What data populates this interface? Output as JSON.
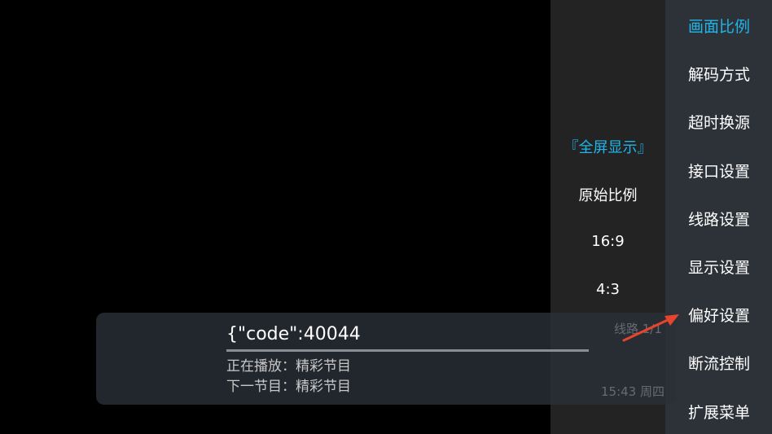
{
  "ratio_options": [
    {
      "label": "『全屏显示』",
      "active": true
    },
    {
      "label": "原始比例",
      "active": false
    },
    {
      "label": "16:9",
      "active": false
    },
    {
      "label": "4:3",
      "active": false
    }
  ],
  "menu": {
    "items": [
      {
        "label": "画面比例",
        "active": true
      },
      {
        "label": "解码方式",
        "active": false
      },
      {
        "label": "超时换源",
        "active": false
      },
      {
        "label": "接口设置",
        "active": false
      },
      {
        "label": "线路设置",
        "active": false
      },
      {
        "label": "显示设置",
        "active": false
      },
      {
        "label": "偏好设置",
        "active": false
      },
      {
        "label": "断流控制",
        "active": false
      },
      {
        "label": "扩展菜单",
        "active": false
      }
    ]
  },
  "player_info": {
    "title": "{\"code\":40044",
    "now_playing": "正在播放：精彩节目",
    "next_program": "下一节目：精彩节目",
    "line": "线路 1/1",
    "clock": "15:43 周四",
    "progress": 1.0
  },
  "colors": {
    "accent": "#20b6ea",
    "annotation_arrow": "#e8432d"
  },
  "icons": {
    "annotation": "arrow-pointer-icon"
  }
}
